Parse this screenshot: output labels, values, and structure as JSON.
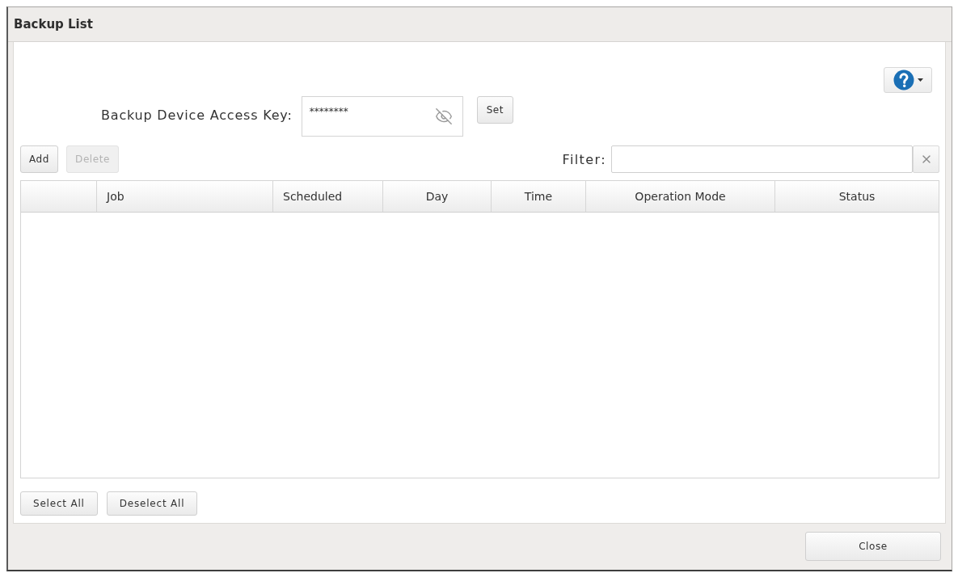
{
  "window": {
    "title": "Backup List"
  },
  "access_key": {
    "label": "Backup Device Access Key:",
    "value": "********",
    "masked": true,
    "button": "Set"
  },
  "toolbar": {
    "buttons": [
      {
        "label": "Add",
        "disabled": false
      },
      {
        "label": "Delete",
        "disabled": true
      }
    ],
    "filter": {
      "label": "Filter:"
    }
  },
  "table": {
    "columns": [
      "Job",
      "Scheduled",
      "Day",
      "Time",
      "Operation Mode",
      "Status"
    ]
  },
  "selection_buttons": [
    "Select All",
    "Deselect All"
  ],
  "footer": {
    "buttons": [
      "Close"
    ]
  }
}
